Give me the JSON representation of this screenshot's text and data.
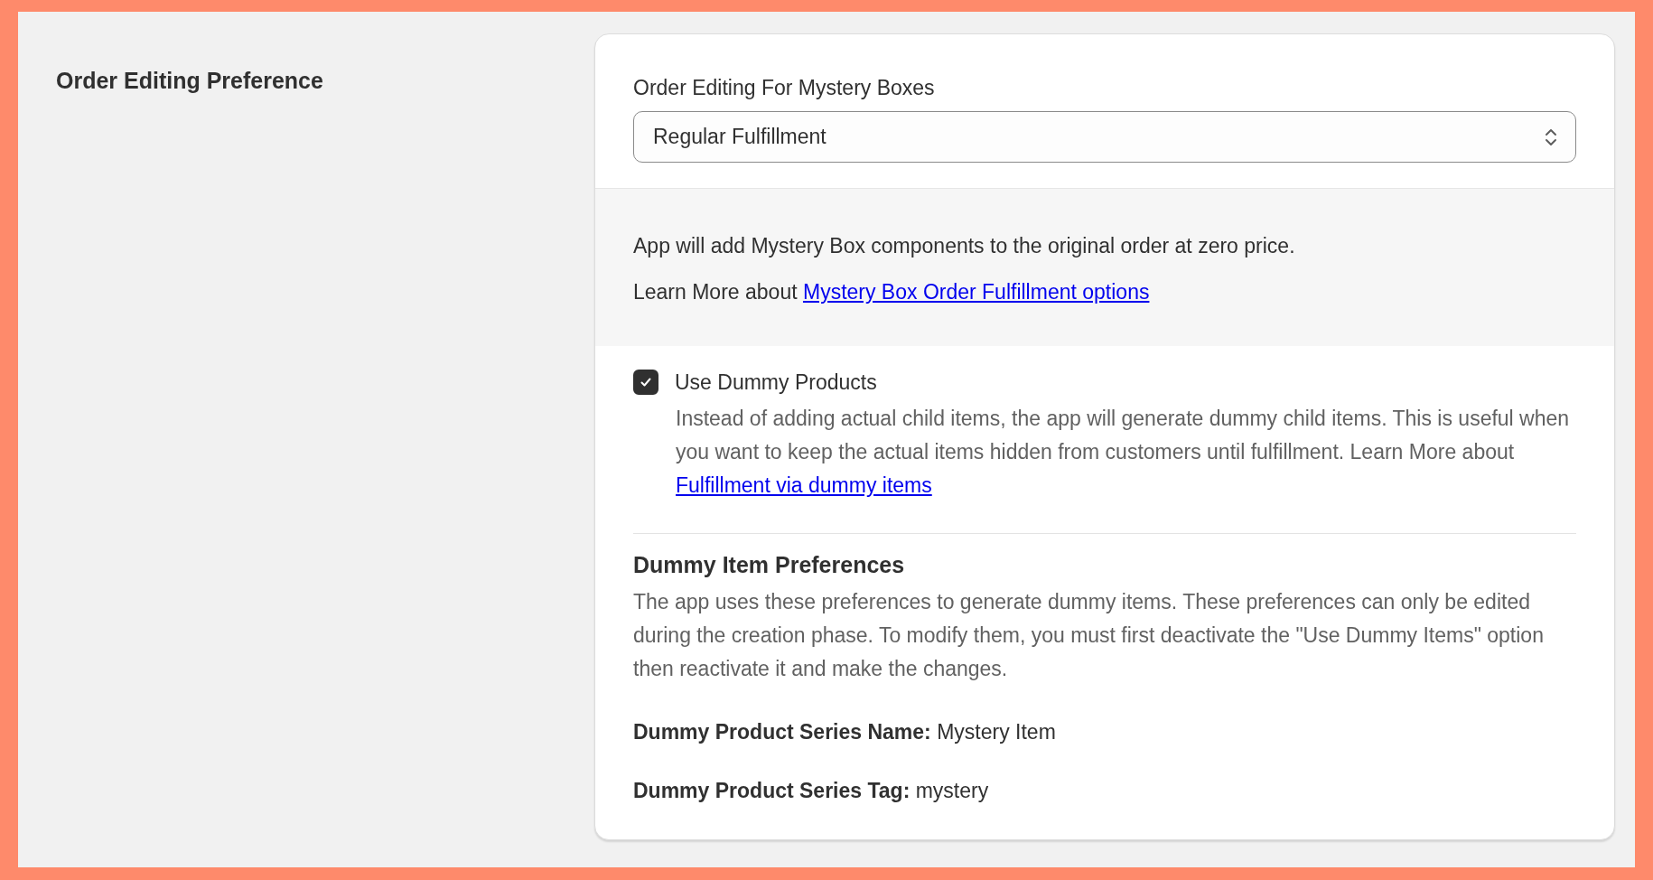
{
  "section": {
    "title": "Order Editing Preference"
  },
  "order_editing": {
    "label": "Order Editing For Mystery Boxes",
    "value": "Regular Fulfillment"
  },
  "info": {
    "text": "App will add Mystery Box components to the original order at zero price.",
    "learn_more_prefix": "Learn More about",
    "link": "Mystery Box Order Fulfillment options"
  },
  "dummy_products": {
    "label": "Use Dummy Products",
    "checked": true,
    "description": "Instead of adding actual child items, the app will generate dummy child items. This is useful when you want to keep the actual items hidden from customers until fulfillment. Learn More about",
    "link": "Fulfillment via dummy items"
  },
  "preferences": {
    "title": "Dummy Item Preferences",
    "description": "The app uses these preferences to generate dummy items. These preferences can only be edited during the creation phase. To modify them, you must first deactivate the \"Use Dummy Items\" option then reactivate it and make the changes.",
    "fields": [
      {
        "text": "**Dummy Product Series Name:** Mystery Item"
      },
      {
        "text": "**Dummy Product Series Tag:** mystery"
      }
    ]
  }
}
